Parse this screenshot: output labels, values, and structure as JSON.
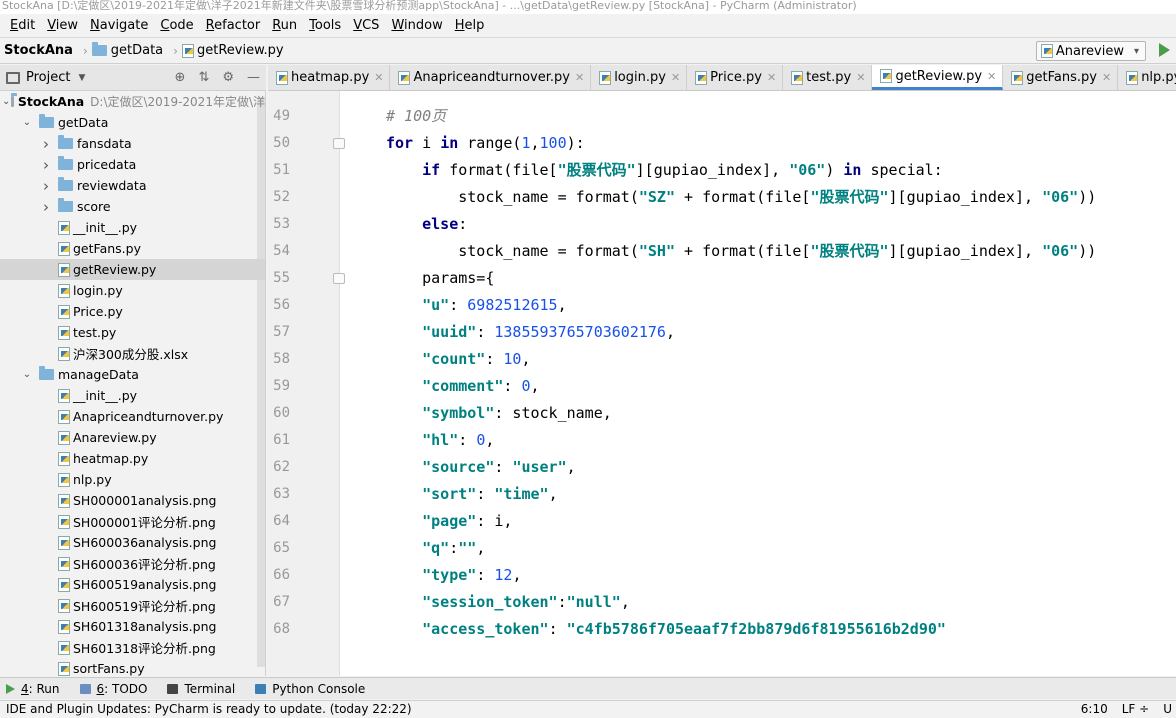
{
  "window": {
    "title": "StockAna [D:\\定做区\\2019-2021年定做\\洋子2021年新建文件夹\\股票雪球分析预测app\\StockAna] - ...\\getData\\getReview.py [StockAna] - PyCharm (Administrator)"
  },
  "menu": [
    {
      "mn": "E",
      "rest": "dit"
    },
    {
      "mn": "V",
      "rest": "iew"
    },
    {
      "mn": "N",
      "rest": "avigate"
    },
    {
      "mn": "C",
      "rest": "ode"
    },
    {
      "mn": "R",
      "rest": "efactor"
    },
    {
      "mn": "R",
      "rest": "un"
    },
    {
      "mn": "T",
      "rest": "ools"
    },
    {
      "mn": "V",
      "rest": "CS"
    },
    {
      "mn": "W",
      "rest": "indow"
    },
    {
      "mn": "H",
      "rest": "elp"
    }
  ],
  "breadcrumb": {
    "project": "StockAna",
    "folder": "getData",
    "file": "getReview.py"
  },
  "run_config": "Anareview",
  "project_panel": {
    "label": "Project"
  },
  "tree": [
    {
      "label": "StockAna",
      "suffix": "D:\\定做区\\2019-2021年定做\\洋",
      "depth": 0,
      "type": "folder",
      "open": true,
      "bold": true
    },
    {
      "label": "getData",
      "depth": 1,
      "type": "folder",
      "open": true
    },
    {
      "label": "fansdata",
      "depth": 2,
      "type": "folder",
      "closed": true
    },
    {
      "label": "pricedata",
      "depth": 2,
      "type": "folder",
      "closed": true
    },
    {
      "label": "reviewdata",
      "depth": 2,
      "type": "folder",
      "closed": true
    },
    {
      "label": "score",
      "depth": 2,
      "type": "folder",
      "closed": true
    },
    {
      "label": "__init__.py",
      "depth": 2,
      "type": "file"
    },
    {
      "label": "getFans.py",
      "depth": 2,
      "type": "file"
    },
    {
      "label": "getReview.py",
      "depth": 2,
      "type": "file",
      "selected": true
    },
    {
      "label": "login.py",
      "depth": 2,
      "type": "file"
    },
    {
      "label": "Price.py",
      "depth": 2,
      "type": "file"
    },
    {
      "label": "test.py",
      "depth": 2,
      "type": "file"
    },
    {
      "label": "沪深300成分股.xlsx",
      "depth": 2,
      "type": "file"
    },
    {
      "label": "manageData",
      "depth": 1,
      "type": "folder",
      "open": true
    },
    {
      "label": "__init__.py",
      "depth": 2,
      "type": "file"
    },
    {
      "label": "Anapriceandturnover.py",
      "depth": 2,
      "type": "file"
    },
    {
      "label": "Anareview.py",
      "depth": 2,
      "type": "file"
    },
    {
      "label": "heatmap.py",
      "depth": 2,
      "type": "file"
    },
    {
      "label": "nlp.py",
      "depth": 2,
      "type": "file"
    },
    {
      "label": "SH000001analysis.png",
      "depth": 2,
      "type": "file"
    },
    {
      "label": "SH000001评论分析.png",
      "depth": 2,
      "type": "file"
    },
    {
      "label": "SH600036analysis.png",
      "depth": 2,
      "type": "file"
    },
    {
      "label": "SH600036评论分析.png",
      "depth": 2,
      "type": "file"
    },
    {
      "label": "SH600519analysis.png",
      "depth": 2,
      "type": "file"
    },
    {
      "label": "SH600519评论分析.png",
      "depth": 2,
      "type": "file"
    },
    {
      "label": "SH601318analysis.png",
      "depth": 2,
      "type": "file"
    },
    {
      "label": "SH601318评论分析.png",
      "depth": 2,
      "type": "file"
    },
    {
      "label": "sortFans.py",
      "depth": 2,
      "type": "file"
    }
  ],
  "tabs": [
    {
      "label": "heatmap.py"
    },
    {
      "label": "Anapriceandturnover.py"
    },
    {
      "label": "login.py"
    },
    {
      "label": "Price.py"
    },
    {
      "label": "test.py"
    },
    {
      "label": "getReview.py",
      "active": true
    },
    {
      "label": "getFans.py"
    },
    {
      "label": "nlp.py"
    }
  ],
  "code_lines": [
    {
      "num": "49",
      "html": "<span class=\"c\"># 100页</span>"
    },
    {
      "num": "50",
      "html": "<span class=\"k\">for</span> i <span class=\"k\">in</span> range(<span class=\"n\">1</span>,<span class=\"n\">100</span>):",
      "fold": true
    },
    {
      "num": "51",
      "html": "    <span class=\"k\">if</span> format(file[<span class=\"s\">\"股票代码\"</span>][gupiao_index], <span class=\"s\">\"06\"</span>) <span class=\"k\">in</span> special:"
    },
    {
      "num": "52",
      "html": "        stock_name = format(<span class=\"s\">\"SZ\"</span> + format(file[<span class=\"s\">\"股票代码\"</span>][gupiao_index], <span class=\"s\">\"06\"</span>))"
    },
    {
      "num": "53",
      "html": "    <span class=\"k\">else</span>:"
    },
    {
      "num": "54",
      "html": "        stock_name = format(<span class=\"s\">\"SH\"</span> + format(file[<span class=\"s\">\"股票代码\"</span>][gupiao_index], <span class=\"s\">\"06\"</span>))"
    },
    {
      "num": "55",
      "html": "    params={",
      "fold": true
    },
    {
      "num": "56",
      "html": "    <span class=\"s\">\"u\"</span>: <span class=\"n\">6982512615</span>,"
    },
    {
      "num": "57",
      "html": "    <span class=\"s\">\"uuid\"</span>: <span class=\"n\">1385593765703602176</span>,"
    },
    {
      "num": "58",
      "html": "    <span class=\"s\">\"count\"</span>: <span class=\"n\">10</span>,"
    },
    {
      "num": "59",
      "html": "    <span class=\"s\">\"comment\"</span>: <span class=\"n\">0</span>,"
    },
    {
      "num": "60",
      "html": "    <span class=\"s\">\"symbol\"</span>: stock_name,"
    },
    {
      "num": "61",
      "html": "    <span class=\"s\">\"hl\"</span>: <span class=\"n\">0</span>,"
    },
    {
      "num": "62",
      "html": "    <span class=\"s\">\"source\"</span>: <span class=\"s\">\"user\"</span>,"
    },
    {
      "num": "63",
      "html": "    <span class=\"s\">\"sort\"</span>: <span class=\"s\">\"time\"</span>,"
    },
    {
      "num": "64",
      "html": "    <span class=\"s\">\"page\"</span>: i,"
    },
    {
      "num": "65",
      "html": "    <span class=\"s\">\"q\"</span>:<span class=\"s\">\"\"</span>,"
    },
    {
      "num": "66",
      "html": "    <span class=\"s\">\"type\"</span>: <span class=\"n\">12</span>,"
    },
    {
      "num": "67",
      "html": "    <span class=\"s\">\"session_token\"</span>:<span class=\"s\">\"null\"</span>,"
    },
    {
      "num": "68",
      "html": "    <span class=\"s\">\"access_token\"</span>: <span class=\"s\">\"c4fb5786f705eaaf7f2bb879d6f81955616b2d90\"</span>"
    }
  ],
  "toolwindows": [
    {
      "pre": "4",
      "label": ": Run"
    },
    {
      "pre": "6",
      "label": ": TODO"
    },
    {
      "pre": "",
      "label": "Terminal"
    },
    {
      "pre": "",
      "label": "Python Console"
    }
  ],
  "status": {
    "message": "IDE and Plugin Updates: PyCharm is ready to update. (today 22:22)",
    "position": "6:10",
    "line_sep": "LF ÷",
    "encoding": "U"
  }
}
